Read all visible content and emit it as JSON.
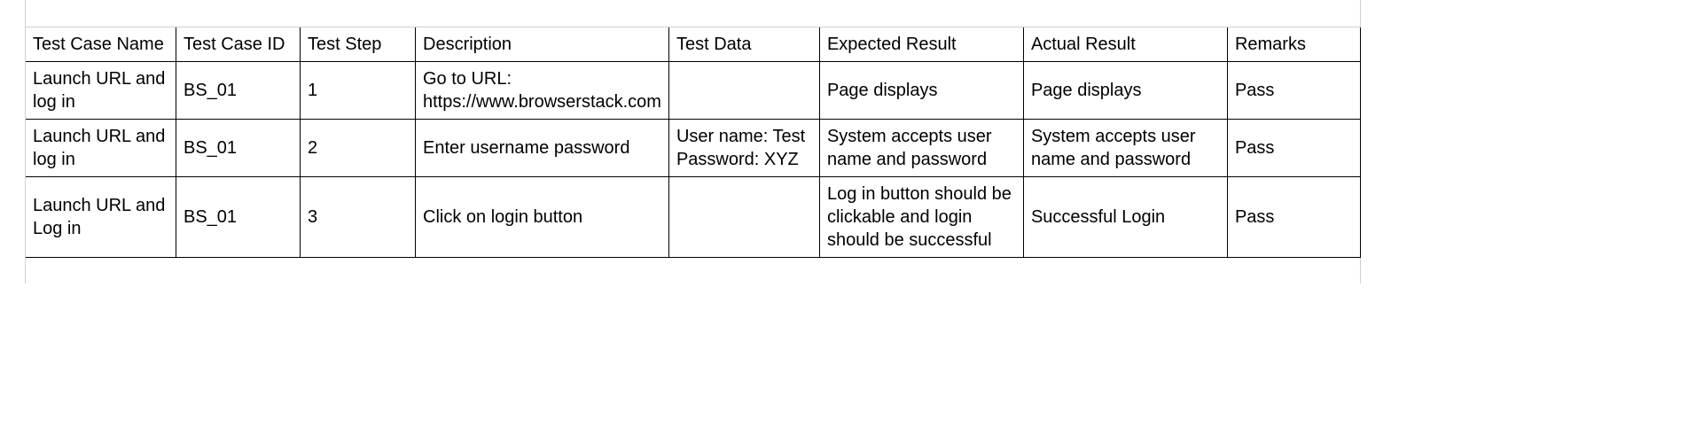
{
  "table": {
    "headers": {
      "test_case_name": "Test Case Name",
      "test_case_id": "Test Case ID",
      "test_step": "Test Step",
      "description": "Description",
      "test_data": "Test Data",
      "expected_result": "Expected Result",
      "actual_result": "Actual Result",
      "remarks": "Remarks"
    },
    "rows": [
      {
        "test_case_name": "Launch URL and log in",
        "test_case_id": "BS_01",
        "test_step": "1",
        "description": "Go to URL: https://www.browserstack.com",
        "test_data": "",
        "expected_result": "Page displays",
        "actual_result": "Page displays",
        "remarks": "Pass"
      },
      {
        "test_case_name": "Launch URL and log in",
        "test_case_id": "BS_01",
        "test_step": "2",
        "description": "Enter username password",
        "test_data": "User name: Test\nPassword: XYZ",
        "expected_result": "System accepts user name and password",
        "actual_result": "System accepts user name and password",
        "remarks": "Pass"
      },
      {
        "test_case_name": "Launch URL and Log in",
        "test_case_id": "BS_01",
        "test_step": "3",
        "description": "Click on login button",
        "test_data": "",
        "expected_result": "Log in button should be clickable and login should be successful",
        "actual_result": "Successful Login",
        "remarks": "Pass"
      }
    ]
  }
}
